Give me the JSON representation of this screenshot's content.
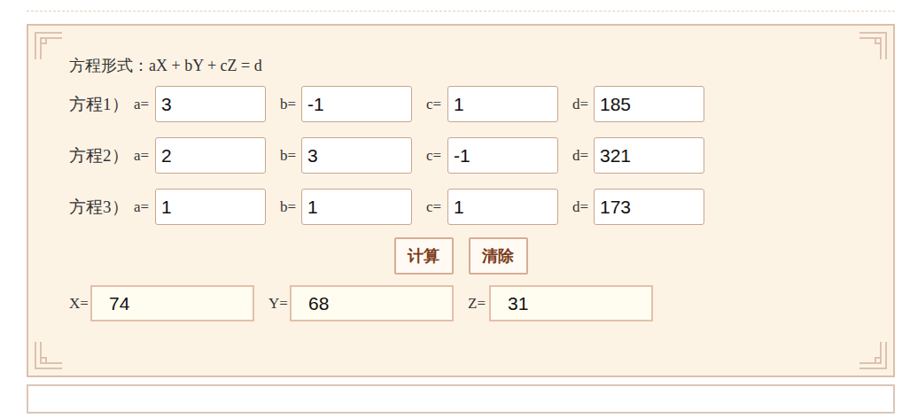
{
  "formula_label": "方程形式：aX + bY + cZ = d",
  "equations": [
    {
      "label": "方程1）",
      "coefficients": [
        {
          "name": "a=",
          "value": "3"
        },
        {
          "name": "b=",
          "value": "-1"
        },
        {
          "name": "c=",
          "value": "1"
        },
        {
          "name": "d=",
          "value": "185"
        }
      ]
    },
    {
      "label": "方程2）",
      "coefficients": [
        {
          "name": "a=",
          "value": "2"
        },
        {
          "name": "b=",
          "value": "3"
        },
        {
          "name": "c=",
          "value": "-1"
        },
        {
          "name": "d=",
          "value": "321"
        }
      ]
    },
    {
      "label": "方程3）",
      "coefficients": [
        {
          "name": "a=",
          "value": "1"
        },
        {
          "name": "b=",
          "value": "1"
        },
        {
          "name": "c=",
          "value": "1"
        },
        {
          "name": "d=",
          "value": "173"
        }
      ]
    }
  ],
  "buttons": [
    "计算",
    "清除"
  ],
  "results": [
    {
      "name": "X=",
      "value": "74"
    },
    {
      "name": "Y=",
      "value": "68"
    },
    {
      "name": "Z=",
      "value": "31"
    }
  ]
}
